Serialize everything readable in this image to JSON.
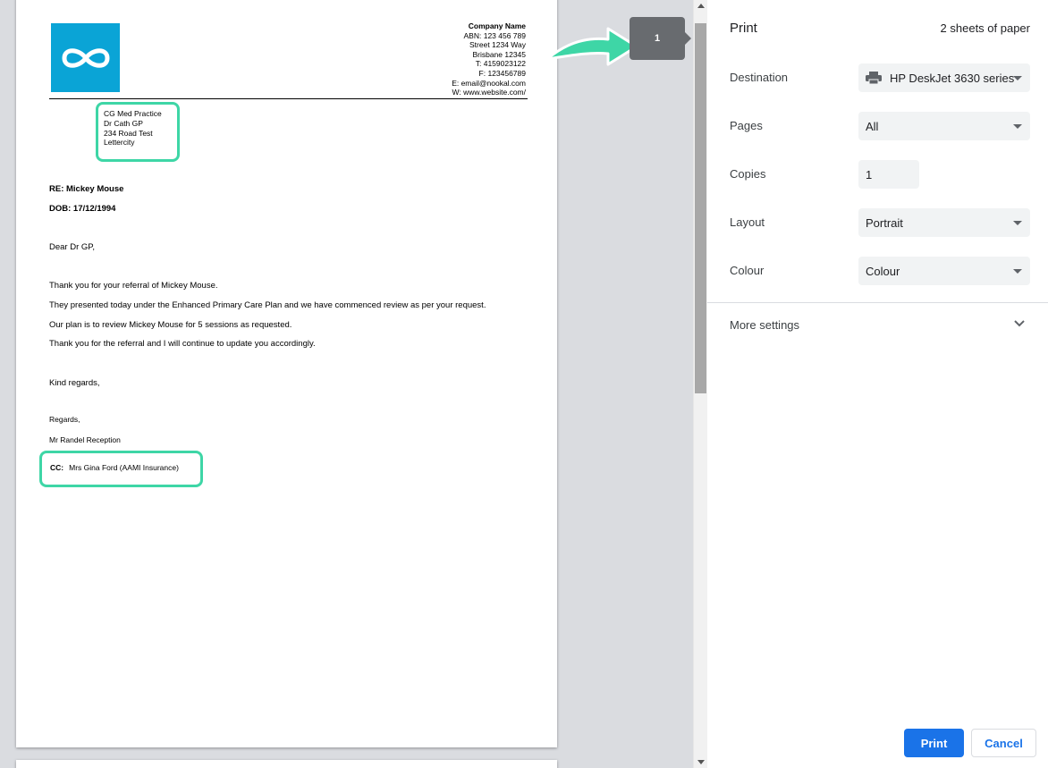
{
  "letter": {
    "company": {
      "name": "Company Name",
      "abn": "ABN: 123 456 789",
      "street": "Street 1234 Way",
      "city": "Brisbane 12345",
      "phone": "T: 4159023122",
      "fax": "F: 123456789",
      "email": "E: email@nookal.com",
      "website": "W: www.website.com/"
    },
    "recipient": [
      "CG Med Practice",
      "Dr Cath GP",
      "234 Road Test",
      "Lettercity"
    ],
    "re": "RE: Mickey Mouse",
    "dob": "DOB: 17/12/1994",
    "greeting": "Dear Dr GP,",
    "paragraphs": [
      "Thank you for your referral of Mickey Mouse.",
      "They presented today under the Enhanced Primary Care Plan and we have commenced review as per your request.",
      "Our plan is to review Mickey Mouse for 5 sessions as requested.",
      "Thank you for the referral and I will continue to update you accordingly."
    ],
    "kind_regards": "Kind regards,",
    "regards": "Regards,",
    "sender": "Mr Randel Reception",
    "cc_label": "CC:",
    "cc_value": "Mrs Gina Ford (AAMI Insurance)"
  },
  "page_badge": "1",
  "print_panel": {
    "title": "Print",
    "sheets": "2 sheets of paper",
    "destination_label": "Destination",
    "destination_value": "HP DeskJet 3630 series",
    "pages_label": "Pages",
    "pages_value": "All",
    "copies_label": "Copies",
    "copies_value": "1",
    "layout_label": "Layout",
    "layout_value": "Portrait",
    "colour_label": "Colour",
    "colour_value": "Colour",
    "more_settings": "More settings",
    "print_button": "Print",
    "cancel_button": "Cancel"
  },
  "colors": {
    "highlight": "#3ed6a6",
    "logo": "#0aa4d6",
    "primary": "#1a73e8"
  }
}
